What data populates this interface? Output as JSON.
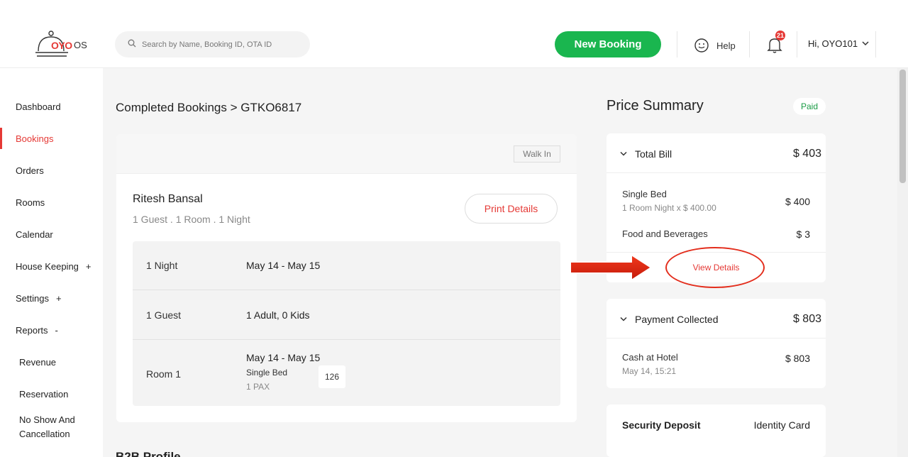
{
  "header": {
    "logo_text": "OYO",
    "logo_os": "OS",
    "search_placeholder": "Search by Name, Booking ID, OTA ID",
    "new_booking_label": "New Booking",
    "help_label": "Help",
    "notification_count": "21",
    "user_greeting": "Hi, OYO101"
  },
  "sidebar": {
    "items": [
      {
        "label": "Dashboard"
      },
      {
        "label": "Bookings"
      },
      {
        "label": "Orders"
      },
      {
        "label": "Rooms"
      },
      {
        "label": "Calendar"
      },
      {
        "label": "House Keeping",
        "toggle": "+"
      },
      {
        "label": "Settings",
        "toggle": "+"
      },
      {
        "label": "Reports",
        "toggle": "-"
      },
      {
        "label": "Revenue"
      },
      {
        "label": "Reservation"
      },
      {
        "label": "No Show And",
        "label2": "Cancellation"
      }
    ]
  },
  "booking": {
    "breadcrumb": "Completed Bookings > GTKO6817",
    "source_tag": "Walk In",
    "guest_name": "Ritesh Bansal",
    "summary": "1 Guest . 1 Room . 1 Night",
    "print_label": "Print Details",
    "rows": [
      {
        "key": "1 Night",
        "value": "May 14 - May 15"
      },
      {
        "key": "1 Guest",
        "value": "1 Adult, 0 Kids"
      },
      {
        "key": "Room 1",
        "value": "May 14 - May 15",
        "room_type": "Single Bed",
        "pax": "1 PAX",
        "room_number": "126"
      }
    ],
    "next_section": "B2B Profile"
  },
  "price_summary": {
    "title": "Price Summary",
    "status": "Paid",
    "total_bill": {
      "label": "Total Bill",
      "amount": "$ 403",
      "items": [
        {
          "label": "Single Bed",
          "sub": "1 Room Night x $ 400.00",
          "amount": "$ 400"
        },
        {
          "label": "Food and Beverages",
          "amount": "$ 3"
        }
      ],
      "view_details": "View Details"
    },
    "payment": {
      "label": "Payment Collected",
      "amount": "$ 803",
      "items": [
        {
          "label": "Cash at Hotel",
          "sub": "May 14, 15:21",
          "amount": "$ 803"
        }
      ]
    },
    "security_deposit": {
      "label": "Security Deposit",
      "value": "Identity Card"
    }
  },
  "colors": {
    "brand_red": "#e53935",
    "brand_green": "#1ab64f",
    "annotation_red": "#e32d1c"
  }
}
